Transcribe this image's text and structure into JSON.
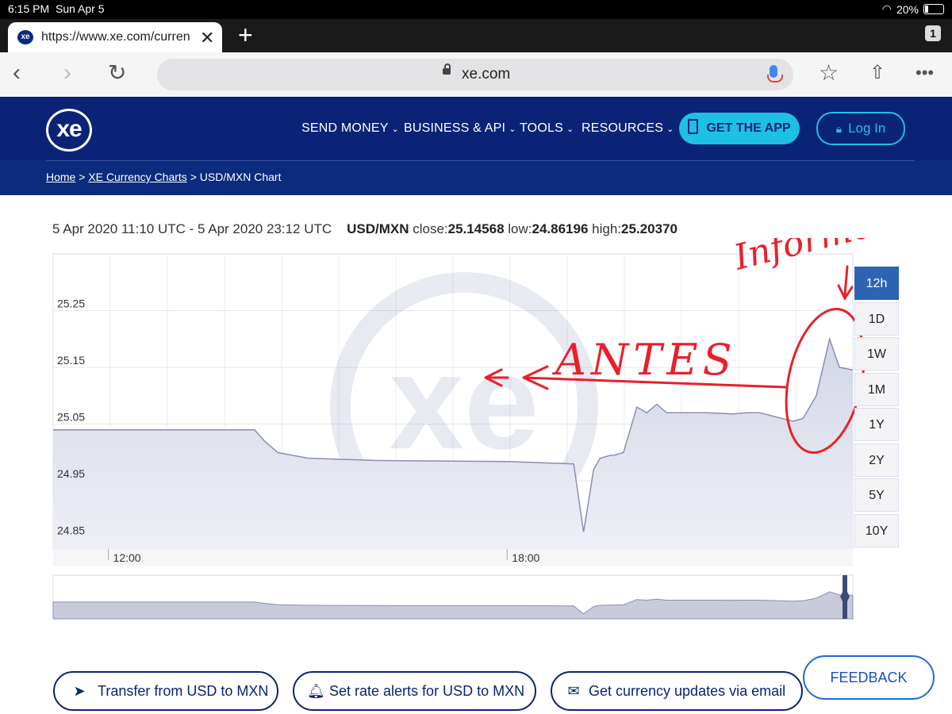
{
  "status_bar": {
    "time": "6:15 PM",
    "date": "Sun Apr 5",
    "battery": "20%"
  },
  "browser": {
    "tab_title": "https://www.xe.com/curren",
    "tab_count": "1",
    "address": "xe.com"
  },
  "site": {
    "logo": "xe",
    "nav": [
      {
        "label": "SEND MONEY"
      },
      {
        "label": "BUSINESS & API"
      },
      {
        "label": "TOOLS"
      },
      {
        "label": "RESOURCES"
      }
    ],
    "get_app": "GET THE APP",
    "login": "Log In"
  },
  "breadcrumb": {
    "home": "Home",
    "sep": ">",
    "charts": "XE Currency Charts",
    "current": "USD/MXN Chart"
  },
  "chart_header": {
    "range": "5 Apr 2020 11:10 UTC - 5 Apr 2020 23:12 UTC",
    "pair": "USD/MXN",
    "close_label": "close:",
    "close": "25.14568",
    "low_label": "low:",
    "low": "24.86196",
    "high_label": "high:",
    "high": "25.20370"
  },
  "range_buttons": [
    "12h",
    "1D",
    "1W",
    "1M",
    "1Y",
    "2Y",
    "5Y",
    "10Y"
  ],
  "active_range": "12h",
  "bottom_buttons": {
    "transfer": "Transfer from USD to MXN",
    "alerts": "Set rate alerts for USD to MXN",
    "updates": "Get currency updates via email",
    "feedback": "FEEDBACK"
  },
  "annotations": {
    "antes": "ANTES",
    "informe": "Informe"
  },
  "colors": {
    "navy": "#0b2376",
    "cyan": "#1ebfe5",
    "active_range": "#2d64b3",
    "ink": "#e8202a"
  },
  "chart_data": {
    "type": "area",
    "y_ticks": [
      "25.25",
      "25.15",
      "25.05",
      "24.95",
      "24.85"
    ],
    "x_ticks": [
      "12:00",
      "18:00"
    ],
    "ylim": [
      24.83,
      25.35
    ],
    "xlim": [
      11.17,
      23.2
    ],
    "grid": true,
    "series": [
      {
        "x": [
          11.17,
          14.2,
          14.35,
          14.55,
          15.0,
          16.0,
          17.0,
          18.0,
          19.0,
          19.05,
          19.15,
          19.22,
          19.3,
          19.4,
          19.55,
          19.6,
          19.75,
          19.95,
          20.1,
          20.25,
          20.4,
          21.0,
          21.4,
          21.6,
          21.8,
          22.3,
          22.45,
          22.65,
          22.85,
          23.0,
          23.2
        ],
        "y": [
          25.04,
          25.04,
          25.02,
          25.0,
          24.99,
          24.986,
          24.985,
          24.984,
          24.98,
          24.94,
          24.86,
          24.91,
          24.97,
          24.99,
          24.995,
          24.995,
          25.0,
          25.08,
          25.07,
          25.085,
          25.07,
          25.07,
          25.068,
          25.07,
          25.07,
          25.055,
          25.06,
          25.1,
          25.2,
          25.15,
          25.14568
        ]
      }
    ]
  }
}
